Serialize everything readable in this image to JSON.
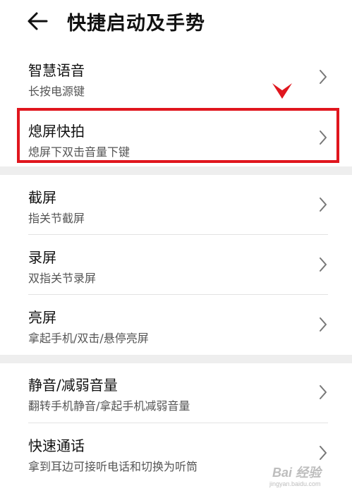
{
  "header": {
    "title": "快捷启动及手势"
  },
  "groups": [
    {
      "items": [
        {
          "title": "智慧语音",
          "subtitle": "长按电源键"
        },
        {
          "title": "熄屏快拍",
          "subtitle": "熄屏下双击音量下键",
          "highlighted": true
        }
      ]
    },
    {
      "items": [
        {
          "title": "截屏",
          "subtitle": "指关节截屏"
        },
        {
          "title": "录屏",
          "subtitle": "双指关节录屏"
        },
        {
          "title": "亮屏",
          "subtitle": "拿起手机/双击/悬停亮屏"
        }
      ]
    },
    {
      "items": [
        {
          "title": "静音/减弱音量",
          "subtitle": "翻转手机静音/拿起手机减弱音量"
        },
        {
          "title": "快速通话",
          "subtitle": "拿到耳边可接听电话和切换为听筒"
        }
      ]
    }
  ],
  "annotation": {
    "highlight_color": "#e0161e"
  },
  "watermark": {
    "brand": "Bai 经验",
    "url": "jingyan.baidu.com"
  },
  "icons": {
    "back": "arrow-left-icon",
    "chevron": "chevron-right-icon"
  }
}
